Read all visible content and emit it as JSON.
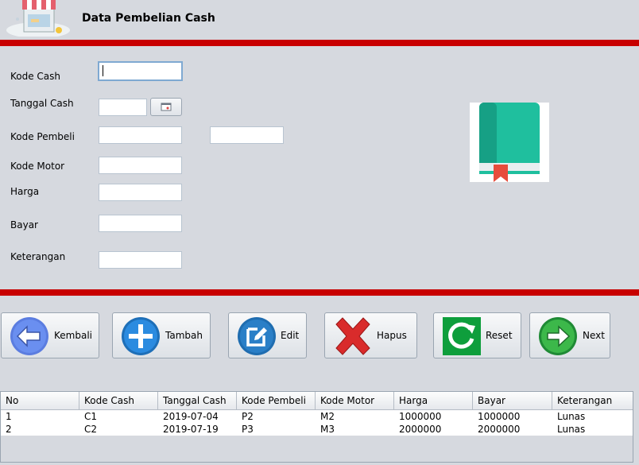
{
  "header": {
    "title": "Data Pembelian Cash"
  },
  "form": {
    "kode_cash": {
      "label": "Kode Cash",
      "value": ""
    },
    "tanggal_cash": {
      "label": "Tanggal Cash",
      "value": ""
    },
    "kode_pembeli": {
      "label": "Kode Pembeli",
      "value": "",
      "value2": ""
    },
    "kode_motor": {
      "label": "Kode Motor",
      "value": ""
    },
    "harga": {
      "label": "Harga",
      "value": ""
    },
    "bayar": {
      "label": "Bayar",
      "value": ""
    },
    "keterangan": {
      "label": "Keterangan",
      "value": ""
    }
  },
  "buttons": {
    "kembali": "Kembali",
    "tambah": "Tambah",
    "edit": "Edit",
    "hapus": "Hapus",
    "reset": "Reset",
    "next": "Next"
  },
  "table": {
    "columns": [
      "No",
      "Kode Cash",
      "Tanggal Cash",
      "Kode Pembeli",
      "Kode Motor",
      "Harga",
      "Bayar",
      "Keterangan"
    ],
    "rows": [
      [
        "1",
        "C1",
        "2019-07-04",
        "P2",
        "M2",
        "1000000",
        "1000000",
        "Lunas"
      ],
      [
        "2",
        "C2",
        "2019-07-19",
        "P3",
        "M3",
        "2000000",
        "2000000",
        "Lunas"
      ]
    ]
  },
  "colors": {
    "accent_red": "#c80000",
    "background": "#d6d9df"
  },
  "icons": {
    "logo": "store-icon",
    "book": "book-icon",
    "calendar": "calendar-icon"
  }
}
